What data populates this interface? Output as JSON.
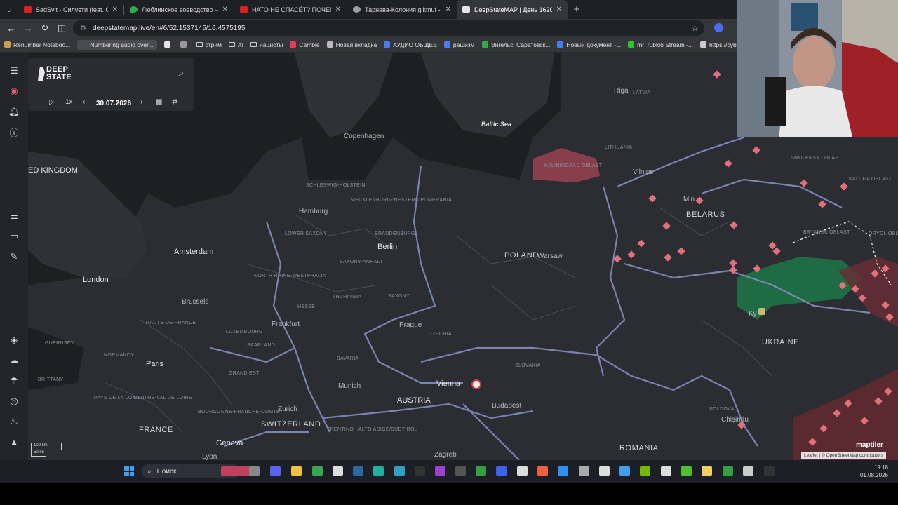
{
  "tabs": [
    {
      "title": "SadSvit - Силуети (feat. СТРУКТ",
      "color": "#e02020"
    },
    {
      "title": "Люблинское воеводство – Go",
      "color": "#34a853"
    },
    {
      "title": "НАТО НЕ СПАСЁТ? ПОЧЕМУ П",
      "color": "#e02020"
    },
    {
      "title": "Тарнава-Колония gjkmuf - По",
      "color": "#9aa0a6"
    },
    {
      "title": "DeepStateMAP | День 1620 | М",
      "color": "#e6e6e6"
    }
  ],
  "address": {
    "url": "deepstatemap.live/en#6/52.1537145/16.4575195"
  },
  "bookmarks": [
    {
      "label": "Renumber Noteboo...",
      "color": "#c8a14a"
    },
    {
      "label": "Numbering audio over...",
      "color": "#4a4b50"
    },
    {
      "label": "",
      "color": "#e6e6e6"
    },
    {
      "label": "",
      "color": "#999"
    },
    {
      "label": "стрим",
      "color": "folder"
    },
    {
      "label": "AI",
      "color": "folder"
    },
    {
      "label": "нацисты",
      "color": "folder"
    },
    {
      "label": "Camble",
      "color": "#e0405a"
    },
    {
      "label": "Новая вкладка",
      "color": "#bbb"
    },
    {
      "label": "АУДИО ОБЩЕЕ",
      "color": "#4a7cf0"
    },
    {
      "label": "рашизм",
      "color": "#4a7cf0"
    },
    {
      "label": "Энгельс, Саратовск...",
      "color": "#34a853"
    },
    {
      "label": "Новый документ -...",
      "color": "#4a7cf0"
    },
    {
      "label": "mr_rubkio Stream -...",
      "color": "#30c030"
    },
    {
      "label": "https://cyber",
      "color": "#ccc"
    }
  ],
  "panel": {
    "logo_line1": "DEEP",
    "logo_line2": "STATE",
    "speed": "1x",
    "date": "30.07.2026"
  },
  "map_labels": {
    "baltic_sea": "Baltic Sea",
    "riga": "Riga",
    "latvia": "LATVIA",
    "copenhagen": "Copenhagen",
    "lithuania": "LITHUANIA",
    "kaliningrad": "KALININGRAD OBLAST",
    "vilnius": "Vilnius",
    "minsk": "Min",
    "belarus": "BELARUS",
    "smolensk": "SMOLENSK OBLAST",
    "kaluga": "KALUGA OBLAST",
    "bryansk": "BRYANSK OBLAST",
    "oryol": "ORYOL OBL",
    "united_kingdom": "ED KINGDOM",
    "schleswig": "SCHLESWIG-HOLSTEIN",
    "hamburg": "Hamburg",
    "mecklenburg": "MECKLENBURG-WESTERN POMERANIA",
    "lower_saxony": "LOWER SAXONY",
    "brandenburg": "BRANDENBURG",
    "berlin": "Berlin",
    "amsterdam": "Amsterdam",
    "saxony_anhalt": "SAXONY-ANHALT",
    "nrw": "NORTH RHINE-WESTPHALIA",
    "poland": "POLAND",
    "warsaw": "Warsaw",
    "london": "London",
    "brussels": "Brussels",
    "hesse": "HESSE",
    "thuringia": "THURINGIA",
    "saxony": "SAXONY",
    "hauts_de_france": "HAUTS-DE-FRANCE",
    "frankfurt": "Frankfurt",
    "prague": "Prague",
    "czechia": "CZECHIA",
    "luxembourg": "LUXEMBOURG",
    "saarland": "SAARLAND",
    "guernsey": "GUERNSEY",
    "normandy": "NORMANDY",
    "paris": "Paris",
    "grand_est": "GRAND EST",
    "bavaria": "BAVARIA",
    "slovakia": "SLOVAKIA",
    "brittany": "BRITTANY",
    "munich": "Munich",
    "vienna": "Vienna",
    "kyiv": "Ky",
    "ukraine": "UKRAINE",
    "austria": "AUSTRIA",
    "budapest": "Budapest",
    "pays_de_la_loire": "PAYS DE LA LOIRE",
    "centre_val_de_loire": "CENTRE-VAL DE LOIRE",
    "bourgogne": "BOURGOGNE-FRANCHE-COMTÉ",
    "zurich": "Zurich",
    "switzerland": "SWITZERLAND",
    "trentino": "TRENTINO - ALTO ADIGE/SÜDTIROL",
    "moldova": "MOLDOVA",
    "chisinau": "Chișinău",
    "france": "FRANCE",
    "geneva": "Geneva",
    "lyon": "Lyon",
    "zagreb": "Zagreb",
    "romania": "ROMANIA",
    "pskov": "PSKOV OBLAST"
  },
  "scale": {
    "km": "100 km",
    "mi": "50 mi"
  },
  "attribution": {
    "leaflet": "Leaflet",
    "osm": "© OpenStreetMap contributors",
    "brand": "maptiler"
  },
  "taskbar": {
    "search": "Поиск",
    "time": "19:18",
    "date": "01.08.2026"
  },
  "colors": {
    "occupied": "#d9545f",
    "liberated": "#1f6b44",
    "border": "#8a93c8",
    "land": "#2b2d33",
    "sea": "#1d1f23"
  }
}
